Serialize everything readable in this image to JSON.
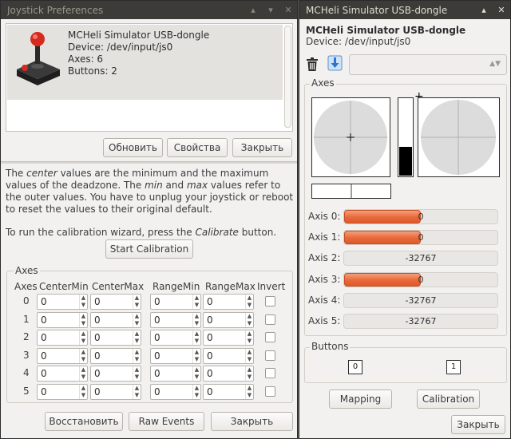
{
  "left_window": {
    "title": "Joystick Preferences",
    "titlebar_buttons": [
      "▴",
      "▾",
      "✕"
    ],
    "device": {
      "name": "MCHeli Simulator USB-dongle",
      "device_line": "Device: /dev/input/js0",
      "axes_line": "Axes: 6",
      "buttons_line": "Buttons: 2"
    },
    "buttons": {
      "refresh": "Обновить",
      "properties": "Свойства",
      "close": "Закрыть"
    },
    "description": {
      "p1_a": "The ",
      "p1_center": "center",
      "p1_b": " values are the minimum and the maximum values of the deadzone. The ",
      "p1_min": "min",
      "p1_c": " and ",
      "p1_max": "max",
      "p1_d": " values refer to the outer values. You have to unplug your joystick or reboot to reset the values to their original default.",
      "p2_a": "To run the calibration wizard, press the ",
      "p2_cal": "Calibrate",
      "p2_b": " button."
    },
    "start_calibration": "Start Calibration",
    "axes_group": {
      "label": "Axes",
      "headers": [
        "Axes",
        "CenterMin",
        "CenterMax",
        "RangeMin",
        "RangeMax",
        "Invert"
      ],
      "rows": [
        {
          "axis": "0",
          "center_min": "0",
          "center_max": "0",
          "range_min": "0",
          "range_max": "0"
        },
        {
          "axis": "1",
          "center_min": "0",
          "center_max": "0",
          "range_min": "0",
          "range_max": "0"
        },
        {
          "axis": "2",
          "center_min": "0",
          "center_max": "0",
          "range_min": "0",
          "range_max": "0"
        },
        {
          "axis": "3",
          "center_min": "0",
          "center_max": "0",
          "range_min": "0",
          "range_max": "0"
        },
        {
          "axis": "4",
          "center_min": "0",
          "center_max": "0",
          "range_min": "0",
          "range_max": "0"
        },
        {
          "axis": "5",
          "center_min": "0",
          "center_max": "0",
          "range_min": "0",
          "range_max": "0"
        }
      ]
    },
    "bottom_buttons": {
      "restore": "Восстановить",
      "raw_events": "Raw Events",
      "close": "Закрыть"
    }
  },
  "right_window": {
    "title": "MCHeli Simulator USB-dongle",
    "titlebar_buttons": [
      "▴",
      "✕"
    ],
    "device_name": "MCHeli Simulator USB-dongle",
    "device_line": "Device: /dev/input/js0",
    "icons": [
      "trash-icon",
      "download-icon"
    ],
    "axes_label": "Axes",
    "axis_bars": [
      {
        "label": "Axis 0:",
        "value": "0",
        "fill": 0.5
      },
      {
        "label": "Axis 1:",
        "value": "0",
        "fill": 0.5
      },
      {
        "label": "Axis 2:",
        "value": "-32767",
        "fill": 0
      },
      {
        "label": "Axis 3:",
        "value": "0",
        "fill": 0.5
      },
      {
        "label": "Axis 4:",
        "value": "-32767",
        "fill": 0
      },
      {
        "label": "Axis 5:",
        "value": "-32767",
        "fill": 0
      }
    ],
    "throttle_level": 0.37,
    "buttons_label": "Buttons",
    "button_states": [
      "0",
      "1"
    ],
    "mapping": "Mapping",
    "calibration": "Calibration",
    "close": "Закрыть"
  },
  "colors": {
    "titlebar": "#3c3b37",
    "window_bg": "#f2f1f0",
    "bar_fill": "#e8683a",
    "selection": "#e4e2df"
  }
}
